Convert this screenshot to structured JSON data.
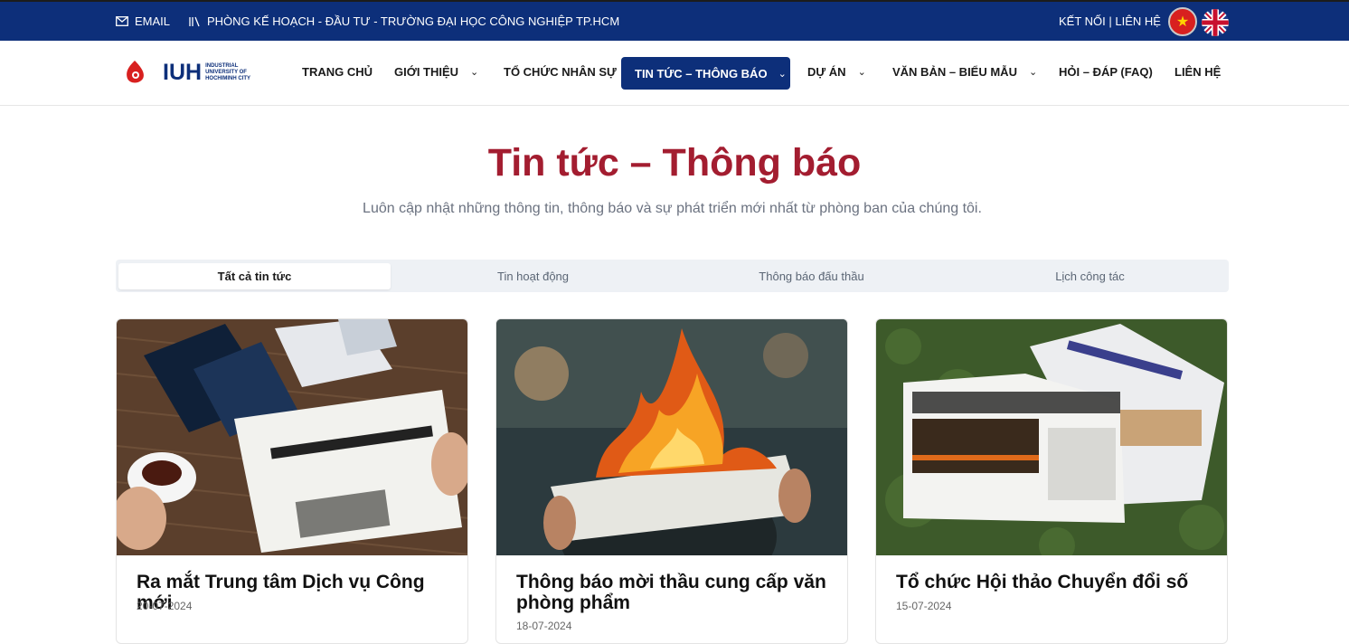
{
  "topbar": {
    "email_label": "EMAIL",
    "department": "PHÒNG KẾ HOẠCH - ĐẦU TƯ - TRƯỜNG ĐẠI HỌC CÔNG NGHIỆP TP.HCM",
    "connect": "KẾT NỐI | LIÊN HỆ"
  },
  "logo": {
    "abbr": "IUH",
    "line1": "INDUSTRIAL",
    "line2": "UNIVERSITY OF",
    "line3": "HOCHIMINH CITY"
  },
  "nav": {
    "home": "TRANG CHỦ",
    "about": "GIỚI THIỆU",
    "staff": "TỔ CHỨC NHÂN SỰ",
    "news": "TIN TỨC – THÔNG BÁO",
    "projects": "DỰ ÁN",
    "docs": "VĂN BẢN – BIỂU MẪU",
    "faq": "HỎI – ĐÁP (FAQ)",
    "contact": "LIÊN HỆ"
  },
  "hero": {
    "title": "Tin tức – Thông báo",
    "subtitle": "Luôn cập nhật những thông tin, thông báo và sự phát triển mới nhất từ phòng ban của chúng tôi."
  },
  "tabs": [
    "Tất cả tin tức",
    "Tin hoạt động",
    "Thông báo đấu thầu",
    "Lịch công tác"
  ],
  "cards": [
    {
      "title": "Ra mắt Trung tâm Dịch vụ Công mới",
      "date": "20-07-2024"
    },
    {
      "title": "Thông báo mời thầu cung cấp văn phòng phẩm",
      "date": "18-07-2024"
    },
    {
      "title": "Tổ chức Hội thảo Chuyển đổi số",
      "date": "15-07-2024"
    }
  ],
  "colors": {
    "brand_blue": "#0d2f7a",
    "title_red": "#a31d30"
  },
  "icons": [
    "envelope-icon",
    "library-icon",
    "vietnam-flag-icon",
    "uk-flag-icon",
    "chevron-down-icon"
  ]
}
